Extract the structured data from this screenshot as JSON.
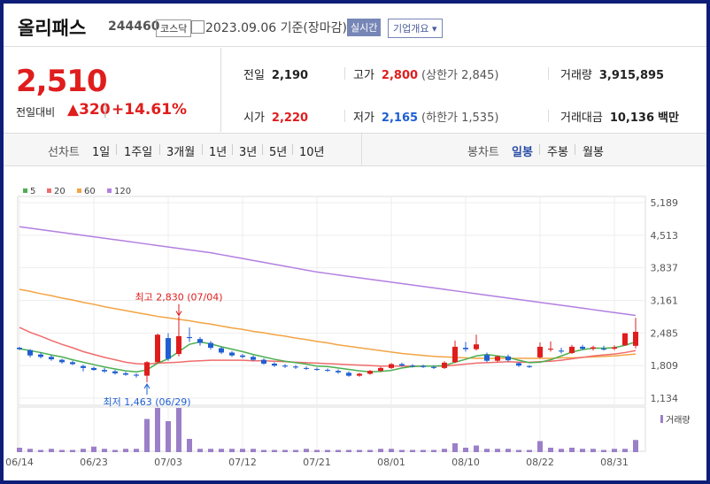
{
  "header": {
    "name": "올리패스",
    "code": "244460",
    "market": "코스닥",
    "date": "2023.09.06",
    "basis": "기준(장마감)",
    "realtime": "실시간",
    "info_label": "기업개요"
  },
  "price": {
    "current": "2,510",
    "change_label": "전일대비",
    "change": "320",
    "change_pct": "+14.61%"
  },
  "stats": {
    "prev_label": "전일",
    "prev": "2,190",
    "high_label": "고가",
    "high": "2,800",
    "upper_limit": "(상한가 2,845)",
    "volume_label": "거래량",
    "volume": "3,915,895",
    "open_label": "시가",
    "open": "2,220",
    "low_label": "저가",
    "low": "2,165",
    "lower_limit": "(하한가 1,535)",
    "amount_label": "거래대금",
    "amount": "10,136",
    "amount_unit": "백만"
  },
  "tabs": {
    "line_label": "선차트",
    "line_periods": [
      "1일",
      "1주일",
      "3개월",
      "1년",
      "3년",
      "5년",
      "10년"
    ],
    "candle_label": "봉차트",
    "candle_periods": [
      "일봉",
      "주봉",
      "월봉"
    ],
    "selected_candle": "일봉"
  },
  "colors": {
    "up": "#e01d1d",
    "down": "#1f5fd2",
    "ma5": "#4caf50",
    "ma20": "#f06c6c",
    "ma60": "#f2a444",
    "ma120": "#b27fe0",
    "volume": "#9b7fc8"
  },
  "chart_data": {
    "type": "candlestick",
    "legend": [
      "5",
      "20",
      "60",
      "120"
    ],
    "y_ticks": [
      "5,189",
      "4,513",
      "3,837",
      "3,161",
      "2,485",
      "1,809",
      "1,134"
    ],
    "ylim": [
      1134,
      5189
    ],
    "x_ticks": [
      "06/14",
      "06/23",
      "07/03",
      "07/12",
      "07/21",
      "08/01",
      "08/10",
      "08/22",
      "08/31"
    ],
    "x_tick_index": [
      0,
      7,
      14,
      21,
      28,
      35,
      42,
      49,
      56
    ],
    "max_label": "최고 2,830 (07/04)",
    "min_label": "최저 1,463 (06/29)",
    "max_index": 15,
    "min_index": 12,
    "volume_label": "거래량",
    "candles": [
      {
        "o": 2180,
        "h": 2200,
        "l": 2130,
        "c": 2150
      },
      {
        "o": 2130,
        "h": 2150,
        "l": 1980,
        "c": 2020
      },
      {
        "o": 2040,
        "h": 2080,
        "l": 1960,
        "c": 1990
      },
      {
        "o": 1990,
        "h": 2030,
        "l": 1910,
        "c": 1940
      },
      {
        "o": 1930,
        "h": 1950,
        "l": 1850,
        "c": 1880
      },
      {
        "o": 1880,
        "h": 1910,
        "l": 1820,
        "c": 1840
      },
      {
        "o": 1800,
        "h": 1830,
        "l": 1690,
        "c": 1760
      },
      {
        "o": 1760,
        "h": 1790,
        "l": 1700,
        "c": 1720
      },
      {
        "o": 1720,
        "h": 1760,
        "l": 1660,
        "c": 1690
      },
      {
        "o": 1690,
        "h": 1720,
        "l": 1620,
        "c": 1650
      },
      {
        "o": 1650,
        "h": 1680,
        "l": 1600,
        "c": 1620
      },
      {
        "o": 1620,
        "h": 1650,
        "l": 1560,
        "c": 1600
      },
      {
        "o": 1600,
        "h": 1900,
        "l": 1463,
        "c": 1880
      },
      {
        "o": 1880,
        "h": 2470,
        "l": 1850,
        "c": 2450
      },
      {
        "o": 2380,
        "h": 2480,
        "l": 1910,
        "c": 1950
      },
      {
        "o": 2050,
        "h": 2830,
        "l": 2000,
        "c": 2420
      },
      {
        "o": 2400,
        "h": 2600,
        "l": 2300,
        "c": 2380
      },
      {
        "o": 2360,
        "h": 2400,
        "l": 2220,
        "c": 2280
      },
      {
        "o": 2280,
        "h": 2320,
        "l": 2140,
        "c": 2180
      },
      {
        "o": 2170,
        "h": 2200,
        "l": 2050,
        "c": 2080
      },
      {
        "o": 2080,
        "h": 2110,
        "l": 1990,
        "c": 2020
      },
      {
        "o": 2020,
        "h": 2050,
        "l": 1960,
        "c": 1990
      },
      {
        "o": 1990,
        "h": 2020,
        "l": 1900,
        "c": 1930
      },
      {
        "o": 1930,
        "h": 1960,
        "l": 1830,
        "c": 1850
      },
      {
        "o": 1850,
        "h": 1880,
        "l": 1780,
        "c": 1810
      },
      {
        "o": 1810,
        "h": 1840,
        "l": 1760,
        "c": 1790
      },
      {
        "o": 1790,
        "h": 1820,
        "l": 1740,
        "c": 1770
      },
      {
        "o": 1760,
        "h": 1790,
        "l": 1720,
        "c": 1750
      },
      {
        "o": 1740,
        "h": 1770,
        "l": 1700,
        "c": 1730
      },
      {
        "o": 1720,
        "h": 1750,
        "l": 1680,
        "c": 1710
      },
      {
        "o": 1700,
        "h": 1730,
        "l": 1640,
        "c": 1670
      },
      {
        "o": 1660,
        "h": 1690,
        "l": 1580,
        "c": 1600
      },
      {
        "o": 1600,
        "h": 1660,
        "l": 1580,
        "c": 1640
      },
      {
        "o": 1640,
        "h": 1720,
        "l": 1620,
        "c": 1700
      },
      {
        "o": 1700,
        "h": 1780,
        "l": 1680,
        "c": 1760
      },
      {
        "o": 1760,
        "h": 1860,
        "l": 1740,
        "c": 1840
      },
      {
        "o": 1840,
        "h": 1870,
        "l": 1790,
        "c": 1810
      },
      {
        "o": 1810,
        "h": 1840,
        "l": 1770,
        "c": 1800
      },
      {
        "o": 1800,
        "h": 1830,
        "l": 1760,
        "c": 1780
      },
      {
        "o": 1780,
        "h": 1810,
        "l": 1740,
        "c": 1760
      },
      {
        "o": 1760,
        "h": 1900,
        "l": 1740,
        "c": 1870
      },
      {
        "o": 1880,
        "h": 2330,
        "l": 1860,
        "c": 2200
      },
      {
        "o": 2180,
        "h": 2300,
        "l": 2100,
        "c": 2150
      },
      {
        "o": 2150,
        "h": 2450,
        "l": 2120,
        "c": 2250
      },
      {
        "o": 2030,
        "h": 2080,
        "l": 1880,
        "c": 1910
      },
      {
        "o": 1910,
        "h": 2020,
        "l": 1880,
        "c": 2000
      },
      {
        "o": 2000,
        "h": 2040,
        "l": 1890,
        "c": 1920
      },
      {
        "o": 1860,
        "h": 1880,
        "l": 1780,
        "c": 1810
      },
      {
        "o": 1800,
        "h": 1820,
        "l": 1760,
        "c": 1780
      },
      {
        "o": 1980,
        "h": 2290,
        "l": 1960,
        "c": 2200
      },
      {
        "o": 2140,
        "h": 2310,
        "l": 2100,
        "c": 2160
      },
      {
        "o": 2120,
        "h": 2180,
        "l": 2060,
        "c": 2100
      },
      {
        "o": 2070,
        "h": 2240,
        "l": 2050,
        "c": 2200
      },
      {
        "o": 2200,
        "h": 2240,
        "l": 2130,
        "c": 2160
      },
      {
        "o": 2160,
        "h": 2220,
        "l": 2120,
        "c": 2190
      },
      {
        "o": 2160,
        "h": 2220,
        "l": 2120,
        "c": 2140
      },
      {
        "o": 2160,
        "h": 2230,
        "l": 2130,
        "c": 2190
      },
      {
        "o": 2230,
        "h": 2480,
        "l": 2220,
        "c": 2480
      },
      {
        "o": 2220,
        "h": 2800,
        "l": 2165,
        "c": 2510
      }
    ],
    "volumes": [
      4,
      3,
      2,
      3,
      2,
      2,
      3,
      5,
      3,
      2,
      3,
      3,
      30,
      40,
      28,
      40,
      12,
      3,
      3,
      3,
      3,
      3,
      3,
      2,
      2,
      2,
      2,
      3,
      2,
      2,
      2,
      2,
      2,
      2,
      3,
      3,
      2,
      2,
      2,
      2,
      3,
      8,
      4,
      6,
      3,
      3,
      3,
      2,
      2,
      10,
      4,
      3,
      4,
      3,
      3,
      2,
      3,
      3,
      11
    ],
    "ma5": [
      2160,
      2120,
      2080,
      2030,
      1990,
      1930,
      1880,
      1830,
      1780,
      1740,
      1700,
      1680,
      1720,
      1860,
      1950,
      2100,
      2250,
      2300,
      2260,
      2200,
      2150,
      2100,
      2040,
      1990,
      1940,
      1900,
      1870,
      1840,
      1800,
      1790,
      1760,
      1730,
      1700,
      1680,
      1690,
      1710,
      1760,
      1790,
      1800,
      1800,
      1810,
      1880,
      1940,
      2010,
      2040,
      2010,
      1980,
      1920,
      1870,
      1880,
      1930,
      2010,
      2090,
      2140,
      2170,
      2170,
      2180,
      2230,
      2300
    ],
    "ma20": [
      2600,
      2500,
      2420,
      2330,
      2250,
      2180,
      2100,
      2040,
      1980,
      1930,
      1880,
      1850,
      1840,
      1860,
      1870,
      1880,
      1900,
      1910,
      1920,
      1920,
      1920,
      1920,
      1910,
      1910,
      1900,
      1890,
      1880,
      1870,
      1860,
      1850,
      1840,
      1830,
      1820,
      1810,
      1800,
      1800,
      1800,
      1800,
      1800,
      1800,
      1800,
      1820,
      1840,
      1860,
      1870,
      1880,
      1890,
      1880,
      1880,
      1890,
      1900,
      1920,
      1950,
      1980,
      2010,
      2030,
      2050,
      2080,
      2120
    ],
    "ma60": [
      3390,
      3350,
      3300,
      3260,
      3210,
      3170,
      3120,
      3080,
      3030,
      2990,
      2950,
      2910,
      2870,
      2830,
      2800,
      2770,
      2740,
      2700,
      2670,
      2630,
      2590,
      2560,
      2520,
      2490,
      2450,
      2420,
      2380,
      2350,
      2310,
      2280,
      2240,
      2210,
      2180,
      2150,
      2120,
      2090,
      2060,
      2040,
      2020,
      2000,
      1990,
      1980,
      1970,
      1960,
      1960,
      1960,
      1960,
      1960,
      1960,
      1960,
      1960,
      1970,
      1970,
      1980,
      1990,
      2000,
      2010,
      2030,
      2050
    ],
    "ma120": [
      4690,
      4660,
      4630,
      4600,
      4570,
      4540,
      4510,
      4480,
      4450,
      4420,
      4390,
      4360,
      4330,
      4300,
      4270,
      4240,
      4210,
      4180,
      4150,
      4110,
      4070,
      4030,
      3990,
      3950,
      3910,
      3870,
      3830,
      3790,
      3750,
      3720,
      3690,
      3660,
      3630,
      3600,
      3570,
      3540,
      3510,
      3480,
      3450,
      3420,
      3390,
      3360,
      3330,
      3300,
      3270,
      3240,
      3210,
      3180,
      3150,
      3120,
      3090,
      3060,
      3030,
      3000,
      2970,
      2940,
      2910,
      2880,
      2850
    ]
  }
}
